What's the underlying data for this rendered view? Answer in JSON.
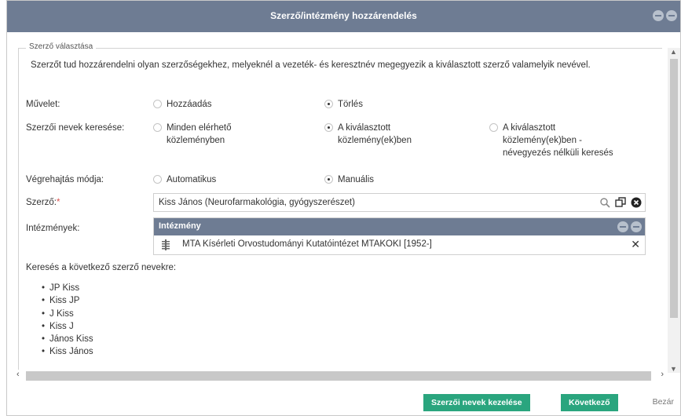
{
  "dialog": {
    "title": "Szerző/intézmény hozzárendelés"
  },
  "section": {
    "legend": "Szerző választása",
    "description": "Szerzőt tud hozzárendelni olyan szerzőségekhez, melyeknél a vezeték- és keresztnév megegyezik a kiválasztott szerző valamelyik nevével."
  },
  "operation": {
    "label": "Művelet:",
    "options": [
      "Hozzáadás",
      "Törlés"
    ],
    "selected": "Törlés"
  },
  "name_search": {
    "label": "Szerzői nevek keresése:",
    "option1_line1": "Minden elérhető",
    "option1_line2": "közleményben",
    "option2_line1": "A kiválasztott",
    "option2_line2": "közlemény(ek)ben",
    "option3_line1": "A kiválasztott",
    "option3_line2": "közlemény(ek)ben -",
    "option3_line3": "névegyezés nélküli keresés",
    "selected": "A kiválasztott közlemény(ek)ben"
  },
  "execution": {
    "label": "Végrehajtás módja:",
    "options": [
      "Automatikus",
      "Manuális"
    ],
    "selected": "Manuális"
  },
  "author": {
    "label": "Szerző:",
    "required_mark": "*",
    "value": "Kiss János (Neurofarmakológia, gyógyszerészet)"
  },
  "institutions": {
    "label": "Intézmények:",
    "grid_header": "Intézmény",
    "rows": [
      "MTA Kísérleti Orvostudományi Kutatóintézet MTAKOKI [1952-]"
    ],
    "remove_glyph": "✕"
  },
  "search_names": {
    "label": "Keresés a következő szerző nevekre:",
    "items": [
      "JP Kiss",
      "Kiss JP",
      "J Kiss",
      "Kiss J",
      "János Kiss",
      "Kiss János"
    ]
  },
  "footer": {
    "manage_names_label": "Szerzői nevek kezelése",
    "next_label": "Következő",
    "close_label": "Bezár"
  },
  "colors": {
    "titlebar": "#6e7c93",
    "button": "#2aa57e"
  },
  "icons": {
    "search": "search-icon",
    "copy": "copy-icon",
    "clear": "clear-icon",
    "drag": "drag-handle-icon"
  }
}
